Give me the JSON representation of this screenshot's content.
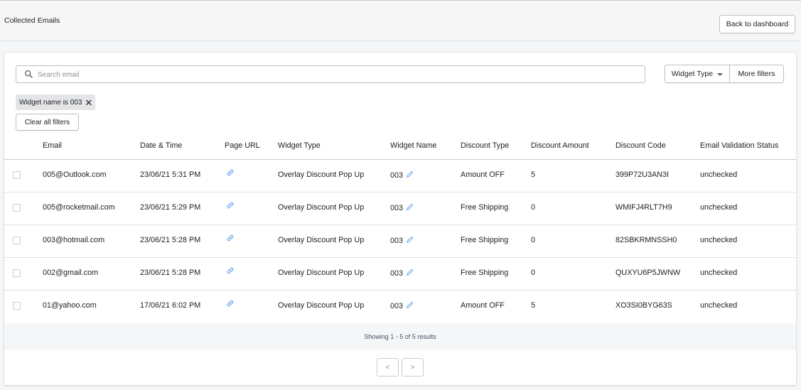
{
  "header": {
    "title": "Collected Emails",
    "back_label": "Back to dashboard"
  },
  "search": {
    "placeholder": "Search email",
    "value": ""
  },
  "filters": {
    "widget_type_label": "Widget Type",
    "more_filters_label": "More filters",
    "applied_tag": "Widget name is 003",
    "clear_all_label": "Clear all filters"
  },
  "table": {
    "columns": [
      "Email",
      "Date & Time",
      "Page URL",
      "Widget Type",
      "Widget Name",
      "Discount Type",
      "Discount Amount",
      "Discount Code",
      "Email Validation Status"
    ],
    "rows": [
      {
        "email": "005@Outlook.com",
        "datetime": "23/06/21 5:31 PM",
        "widget_type": "Overlay Discount Pop Up",
        "widget_name": "003",
        "discount_type": "Amount OFF",
        "discount_amount": "5",
        "discount_code": "399P72U3AN3I",
        "status": "unchecked"
      },
      {
        "email": "005@rocketmail.com",
        "datetime": "23/06/21 5:29 PM",
        "widget_type": "Overlay Discount Pop Up",
        "widget_name": "003",
        "discount_type": "Free Shipping",
        "discount_amount": "0",
        "discount_code": "WMIFJ4RLT7H9",
        "status": "unchecked"
      },
      {
        "email": "003@hotmail.com",
        "datetime": "23/06/21 5:28 PM",
        "widget_type": "Overlay Discount Pop Up",
        "widget_name": "003",
        "discount_type": "Free Shipping",
        "discount_amount": "0",
        "discount_code": "82SBKRMNSSH0",
        "status": "unchecked"
      },
      {
        "email": "002@gmail.com",
        "datetime": "23/06/21 5:28 PM",
        "widget_type": "Overlay Discount Pop Up",
        "widget_name": "003",
        "discount_type": "Free Shipping",
        "discount_amount": "0",
        "discount_code": "QUXYU6P5JWNW",
        "status": "unchecked"
      },
      {
        "email": "01@yahoo.com",
        "datetime": "17/06/21 6:02 PM",
        "widget_type": "Overlay Discount Pop Up",
        "widget_name": "003",
        "discount_type": "Amount OFF",
        "discount_amount": "5",
        "discount_code": "XO3SI0BYG63S",
        "status": "unchecked"
      }
    ]
  },
  "pagination": {
    "summary": "Showing 1 - 5 of 5 results",
    "prev_label": "<",
    "next_label": ">"
  },
  "icons": {
    "search": "search-icon",
    "link": "link-icon",
    "edit": "pencil-icon",
    "close": "close-icon",
    "caret": "caret-down-icon"
  },
  "colors": {
    "link_icon": "#5c9ded",
    "background": "#f4f6f8",
    "tag_bg": "#e4e5e7"
  }
}
